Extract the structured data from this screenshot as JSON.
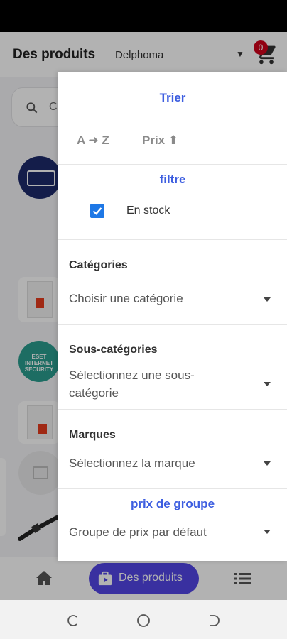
{
  "app": {
    "title": "Des produits",
    "store_name": "Delphoma",
    "cart_count": "0",
    "search_placeholder": "C",
    "thumb_3_text": "ESET INTERNET SECURITY"
  },
  "bottom_nav": {
    "products_label": "Des produits"
  },
  "filter_panel": {
    "sort_title": "Trier",
    "sort_az_label": "A ➜ Z",
    "sort_price_label": "Prix ⬆",
    "filter_title": "filtre",
    "in_stock_label": "En stock",
    "in_stock_checked": true,
    "categories_label": "Catégories",
    "categories_value": "Choisir une catégorie",
    "subcategories_label": "Sous-catégories",
    "subcategories_value": "Sélectionnez une sous-catégorie",
    "brands_label": "Marques",
    "brands_value": "Sélectionnez la marque",
    "price_group_title": "prix de groupe",
    "price_group_value": "Groupe de prix par défaut"
  },
  "colors": {
    "accent_blue": "#3d5ee0",
    "nav_pill": "#5246e6",
    "checkbox": "#1e78e6",
    "badge": "#d0021b"
  }
}
